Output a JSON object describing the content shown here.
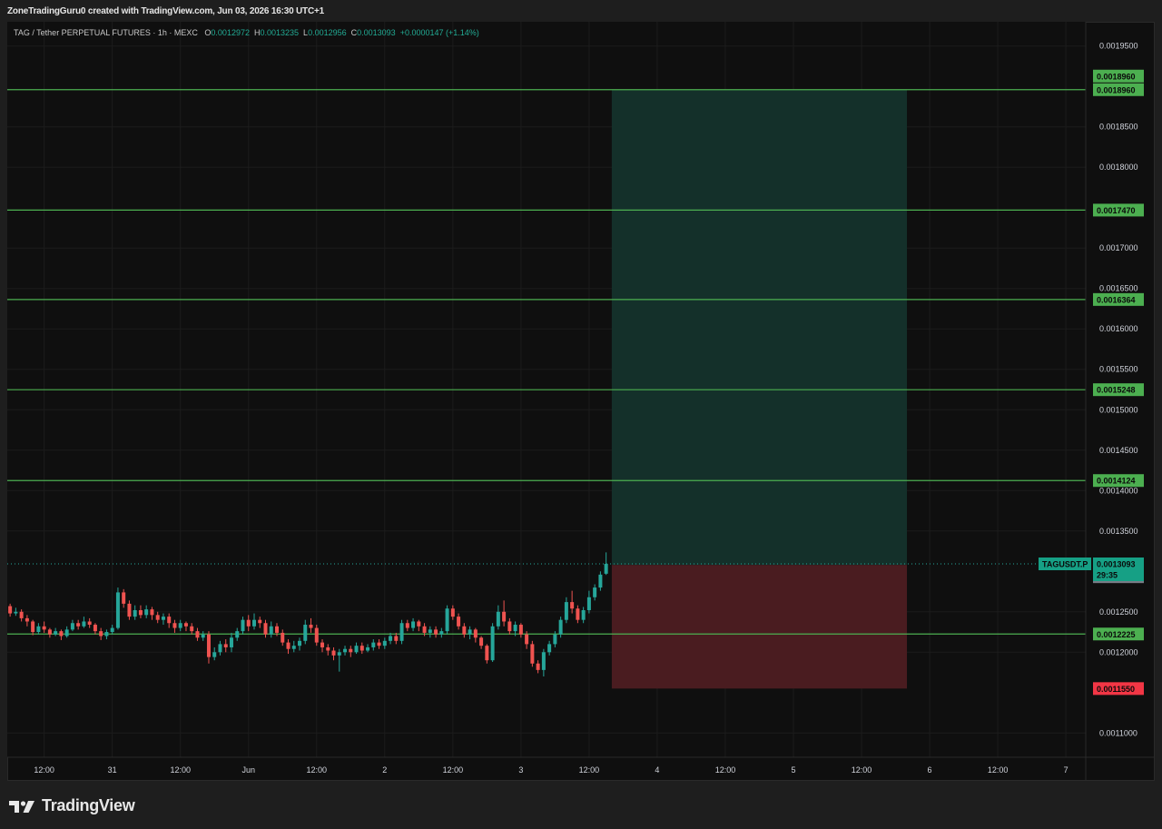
{
  "header": {
    "credit": "ZoneTradingGuru0 created with TradingView.com, Jun 03, 2026 16:30 UTC+1"
  },
  "legend": {
    "symbol": "TAG / Tether PERPETUAL FUTURES · 1h · MEXC",
    "o_label": "O",
    "o": "0.0012972",
    "h_label": "H",
    "h": "0.0013235",
    "l_label": "L",
    "l": "0.0012956",
    "c_label": "C",
    "c": "0.0013093",
    "change": "+0.0000147 (+1.14%)"
  },
  "brand": {
    "name": "TradingView"
  },
  "colors": {
    "background": "#0f0f0f",
    "grid": "#1c1c1c",
    "up": "#26a69a",
    "down": "#ef5350",
    "level_line": "#4caf50",
    "profit_zone": "#14302a",
    "loss_zone": "#4a1c20",
    "stop_tag": "#f23645",
    "symbol_tag": "#16a085",
    "last_tag": "#787b86"
  },
  "chart_data": {
    "type": "candlestick",
    "symbol": "TAGUSDT.P",
    "y_ticks": [
      "0.0019500",
      "0.0018500",
      "0.0018000",
      "0.0017000",
      "0.0016500",
      "0.0016000",
      "0.0015500",
      "0.0015000",
      "0.0014500",
      "0.0014000",
      "0.0013500",
      "0.0012500",
      "0.0012000",
      "0.0011000"
    ],
    "y_range": [
      0.00107,
      0.00198
    ],
    "x_ticks": [
      {
        "label": "12:00",
        "hour": -84
      },
      {
        "label": "31",
        "hour": -72
      },
      {
        "label": "12:00",
        "hour": -60
      },
      {
        "label": "Jun",
        "hour": -48
      },
      {
        "label": "12:00",
        "hour": -36
      },
      {
        "label": "2",
        "hour": -24
      },
      {
        "label": "12:00",
        "hour": -12
      },
      {
        "label": "3",
        "hour": 0
      },
      {
        "label": "12:00",
        "hour": 12
      },
      {
        "label": "4",
        "hour": 24
      },
      {
        "label": "12:00",
        "hour": 36
      },
      {
        "label": "5",
        "hour": 48
      },
      {
        "label": "12:00",
        "hour": 60
      },
      {
        "label": "6",
        "hour": 72
      },
      {
        "label": "12:00",
        "hour": 84
      },
      {
        "label": "7",
        "hour": 96
      }
    ],
    "x_range_hours": [
      -90.5,
      99.5
    ],
    "horizontal_levels": [
      {
        "price": 0.001896,
        "label": "0.0018960"
      },
      {
        "price": 0.001747,
        "label": "0.0017470"
      },
      {
        "price": 0.0016364,
        "label": "0.0016364"
      },
      {
        "price": 0.0015248,
        "label": "0.0015248"
      },
      {
        "price": 0.0014124,
        "label": "0.0014124"
      },
      {
        "price": 0.0012225,
        "label": "0.0012225"
      }
    ],
    "position": {
      "entry": 0.001308,
      "target": 0.001896,
      "stop": 0.001155,
      "start_hour": 16,
      "end_hour": 68,
      "target_labels": [
        "0.0018960",
        "0.0018960"
      ],
      "stop_label": "0.0011550",
      "entry_label": "0.0013080"
    },
    "last_price": {
      "price": 0.0013093,
      "label": "0.0013093",
      "countdown": "29:35",
      "symbol_label": "TAGUSDT.P"
    },
    "candles": [
      [
        0.001252,
        0.001254,
        0.00126,
        0.001248
      ],
      [
        0.001254,
        0.001257,
        0.001262,
        0.00125
      ],
      [
        0.001257,
        0.001248,
        0.00126,
        0.001244
      ],
      [
        0.001248,
        0.00125,
        0.001255,
        0.001245
      ],
      [
        0.00125,
        0.001242,
        0.001253,
        0.001238
      ],
      [
        0.001242,
        0.001238,
        0.001246,
        0.001232
      ],
      [
        0.001238,
        0.001225,
        0.00124,
        0.001221
      ],
      [
        0.001225,
        0.001232,
        0.001236,
        0.001222
      ],
      [
        0.001232,
        0.001228,
        0.001238,
        0.001224
      ],
      [
        0.001228,
        0.001222,
        0.00123,
        0.001218
      ],
      [
        0.001222,
        0.001226,
        0.00123,
        0.00122
      ],
      [
        0.001226,
        0.00122,
        0.001228,
        0.001215
      ],
      [
        0.00122,
        0.001228,
        0.001232,
        0.001218
      ],
      [
        0.001228,
        0.001236,
        0.00124,
        0.001226
      ],
      [
        0.001236,
        0.001232,
        0.00124,
        0.001228
      ],
      [
        0.001232,
        0.001238,
        0.001244,
        0.00123
      ],
      [
        0.001238,
        0.001234,
        0.001242,
        0.00123
      ],
      [
        0.001234,
        0.001226,
        0.001236,
        0.001222
      ],
      [
        0.001226,
        0.00122,
        0.00123,
        0.001215
      ],
      [
        0.00122,
        0.001225,
        0.001228,
        0.001216
      ],
      [
        0.001225,
        0.00123,
        0.001234,
        0.001222
      ],
      [
        0.00123,
        0.001274,
        0.00128,
        0.001228
      ],
      [
        0.001274,
        0.00126,
        0.001278,
        0.001255
      ],
      [
        0.00126,
        0.001244,
        0.001264,
        0.00124
      ],
      [
        0.001244,
        0.001252,
        0.001258,
        0.00124
      ],
      [
        0.001252,
        0.001246,
        0.001258,
        0.001242
      ],
      [
        0.001246,
        0.001253,
        0.001258,
        0.001242
      ],
      [
        0.001253,
        0.001246,
        0.001256,
        0.00124
      ],
      [
        0.001246,
        0.00124,
        0.00125,
        0.001236
      ],
      [
        0.00124,
        0.001244,
        0.001248,
        0.001234
      ],
      [
        0.001244,
        0.001236,
        0.001248,
        0.00123
      ],
      [
        0.001236,
        0.00123,
        0.00124,
        0.001224
      ],
      [
        0.00123,
        0.001236,
        0.00124,
        0.001226
      ],
      [
        0.001236,
        0.001232,
        0.001238,
        0.001226
      ],
      [
        0.001232,
        0.001226,
        0.001236,
        0.001222
      ],
      [
        0.001226,
        0.001218,
        0.00123,
        0.001214
      ],
      [
        0.001218,
        0.001222,
        0.001226,
        0.001214
      ],
      [
        0.001222,
        0.001194,
        0.001226,
        0.001186
      ],
      [
        0.001194,
        0.0012,
        0.001206,
        0.00119
      ],
      [
        0.0012,
        0.00121,
        0.001214,
        0.001196
      ],
      [
        0.00121,
        0.001206,
        0.001216,
        0.0012
      ],
      [
        0.001206,
        0.001218,
        0.001224,
        0.0012
      ],
      [
        0.001218,
        0.001226,
        0.00123,
        0.001214
      ],
      [
        0.001226,
        0.00124,
        0.001244,
        0.001222
      ],
      [
        0.00124,
        0.001232,
        0.001246,
        0.001226
      ],
      [
        0.001232,
        0.00124,
        0.001248,
        0.001228
      ],
      [
        0.00124,
        0.001236,
        0.001244,
        0.00123
      ],
      [
        0.001236,
        0.001222,
        0.00124,
        0.001218
      ],
      [
        0.001222,
        0.001232,
        0.001238,
        0.001218
      ],
      [
        0.001232,
        0.001224,
        0.001236,
        0.00122
      ],
      [
        0.001224,
        0.001212,
        0.001228,
        0.001208
      ],
      [
        0.001212,
        0.001204,
        0.001216,
        0.001198
      ],
      [
        0.001204,
        0.001208,
        0.001214,
        0.0012
      ],
      [
        0.001208,
        0.001214,
        0.001218,
        0.001202
      ],
      [
        0.001214,
        0.001234,
        0.00124,
        0.00121
      ],
      [
        0.001234,
        0.00123,
        0.001242,
        0.001224
      ],
      [
        0.00123,
        0.001212,
        0.001234,
        0.001208
      ],
      [
        0.001212,
        0.001206,
        0.001216,
        0.0012
      ],
      [
        0.001206,
        0.001202,
        0.00121,
        0.001196
      ],
      [
        0.001202,
        0.001196,
        0.001206,
        0.00119
      ],
      [
        0.001196,
        0.0012,
        0.001204,
        0.001176
      ],
      [
        0.0012,
        0.001204,
        0.001208,
        0.001196
      ],
      [
        0.001204,
        0.0012,
        0.001208,
        0.001194
      ],
      [
        0.0012,
        0.001208,
        0.001212,
        0.001198
      ],
      [
        0.001208,
        0.001202,
        0.001212,
        0.001198
      ],
      [
        0.001202,
        0.001206,
        0.00121,
        0.0012
      ],
      [
        0.001206,
        0.001212,
        0.001216,
        0.001202
      ],
      [
        0.001212,
        0.001208,
        0.001216,
        0.001204
      ],
      [
        0.001208,
        0.001214,
        0.001218,
        0.001204
      ],
      [
        0.001214,
        0.00122,
        0.001224,
        0.00121
      ],
      [
        0.00122,
        0.001214,
        0.001224,
        0.00121
      ],
      [
        0.001214,
        0.001236,
        0.00124,
        0.00121
      ],
      [
        0.001236,
        0.00123,
        0.00124,
        0.001226
      ],
      [
        0.00123,
        0.001238,
        0.001242,
        0.001226
      ],
      [
        0.001238,
        0.001232,
        0.00124,
        0.001226
      ],
      [
        0.001232,
        0.001224,
        0.001236,
        0.00122
      ],
      [
        0.001224,
        0.001228,
        0.001232,
        0.001218
      ],
      [
        0.001228,
        0.001222,
        0.001232,
        0.001218
      ],
      [
        0.001222,
        0.001226,
        0.00123,
        0.001218
      ],
      [
        0.001226,
        0.001254,
        0.001258,
        0.001222
      ],
      [
        0.001254,
        0.001244,
        0.001258,
        0.00124
      ],
      [
        0.001244,
        0.001232,
        0.001248,
        0.001228
      ],
      [
        0.001232,
        0.001222,
        0.001236,
        0.001218
      ],
      [
        0.001222,
        0.001228,
        0.001232,
        0.001216
      ],
      [
        0.001228,
        0.001218,
        0.00123,
        0.001212
      ],
      [
        0.001218,
        0.001208,
        0.00122,
        0.001204
      ],
      [
        0.001208,
        0.00119,
        0.00121,
        0.001186
      ],
      [
        0.00119,
        0.001232,
        0.001236,
        0.001188
      ],
      [
        0.001232,
        0.00125,
        0.001258,
        0.001228
      ],
      [
        0.00125,
        0.001238,
        0.001264,
        0.001232
      ],
      [
        0.001238,
        0.001226,
        0.001242,
        0.001222
      ],
      [
        0.001226,
        0.001234,
        0.001238,
        0.00122
      ],
      [
        0.001234,
        0.001222,
        0.001236,
        0.001218
      ],
      [
        0.001222,
        0.00121,
        0.001226,
        0.001204
      ],
      [
        0.00121,
        0.001186,
        0.001214,
        0.001182
      ],
      [
        0.001186,
        0.001178,
        0.00119,
        0.001174
      ],
      [
        0.001178,
        0.0012,
        0.001204,
        0.00117
      ],
      [
        0.0012,
        0.00121,
        0.001214,
        0.001196
      ],
      [
        0.00121,
        0.001222,
        0.001226,
        0.001206
      ],
      [
        0.001222,
        0.00124,
        0.001244,
        0.001218
      ],
      [
        0.00124,
        0.001262,
        0.001268,
        0.001236
      ],
      [
        0.001262,
        0.001254,
        0.001276,
        0.001248
      ],
      [
        0.001254,
        0.00124,
        0.001258,
        0.001236
      ],
      [
        0.00124,
        0.001252,
        0.001256,
        0.001236
      ],
      [
        0.001252,
        0.001268,
        0.001276,
        0.001248
      ],
      [
        0.001268,
        0.00128,
        0.001284,
        0.001264
      ],
      [
        0.00128,
        0.001296,
        0.0013,
        0.001276
      ],
      [
        0.00129709,
        0.0013093,
        0.0013235,
        0.0012956
      ]
    ]
  }
}
